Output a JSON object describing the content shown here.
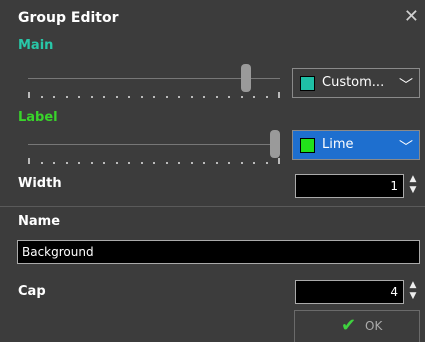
{
  "window": {
    "title": "Group Editor"
  },
  "colors": {
    "main": "#28c7a8",
    "label": "#39d42b",
    "accent": "#1e6fcf"
  },
  "main": {
    "label": "Main",
    "slider_level": 0.88,
    "combo_value": "Custom...",
    "swatch_color": "#1fbfa6"
  },
  "label_section": {
    "label": "Label",
    "slider_level": 1.0,
    "combo_value": "Lime",
    "swatch_color": "#22e21a"
  },
  "width": {
    "label": "Width",
    "value": "1"
  },
  "name": {
    "label": "Name",
    "value": "Background"
  },
  "cap": {
    "label": "Cap",
    "value": "4"
  },
  "ok": {
    "label": "OK"
  },
  "icons": {
    "close": "close-icon",
    "chevron": "chevron-down-icon",
    "spin": "spin-arrows-icon",
    "check": "check-icon"
  }
}
